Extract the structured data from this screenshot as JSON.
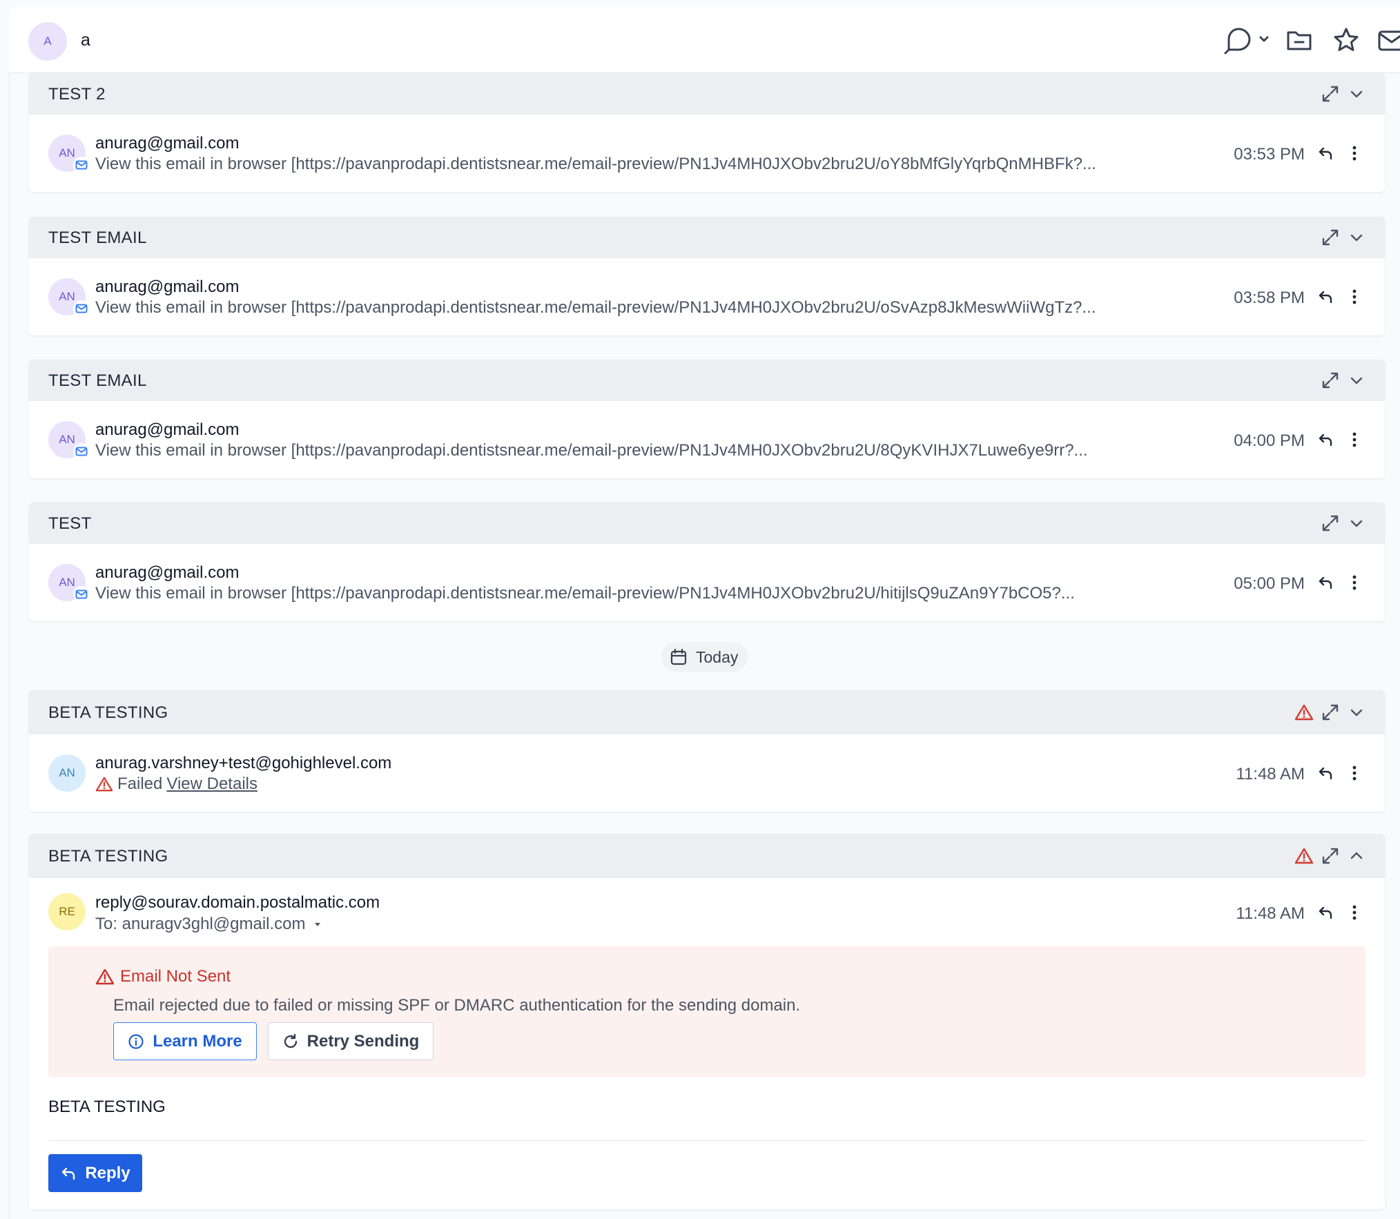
{
  "header": {
    "avatar_initials": "A",
    "contact_name": "a"
  },
  "threads": [
    {
      "subject": "TEST 2",
      "sender": "anurag@gmail.com",
      "avatar": "AN",
      "preview": "View this email in browser [https://pavanprodapi.dentistsnear.me/email-preview/PN1Jv4MH0JXObv2bru2U/oY8bMfGlyYqrbQnMHBFk?...",
      "time": "03:53 PM"
    },
    {
      "subject": "TEST EMAIL",
      "sender": "anurag@gmail.com",
      "avatar": "AN",
      "preview": "View this email in browser [https://pavanprodapi.dentistsnear.me/email-preview/PN1Jv4MH0JXObv2bru2U/oSvAzp8JkMeswWiiWgTz?...",
      "time": "03:58 PM"
    },
    {
      "subject": "TEST EMAIL",
      "sender": "anurag@gmail.com",
      "avatar": "AN",
      "preview": "View this email in browser [https://pavanprodapi.dentistsnear.me/email-preview/PN1Jv4MH0JXObv2bru2U/8QyKVIHJX7Luwe6ye9rr?...",
      "time": "04:00 PM"
    },
    {
      "subject": "TEST",
      "sender": "anurag@gmail.com",
      "avatar": "AN",
      "preview": "View this email in browser [https://pavanprodapi.dentistsnear.me/email-preview/PN1Jv4MH0JXObv2bru2U/hitijlsQ9uZAn9Y7bCO5?...",
      "time": "05:00 PM"
    }
  ],
  "date_separator": "Today",
  "failed_thread": {
    "subject": "BETA TESTING",
    "sender": "anurag.varshney+test@gohighlevel.com",
    "avatar": "AN",
    "status": "Failed",
    "view_details": "View Details",
    "time": "11:48 AM"
  },
  "expanded_thread": {
    "subject": "BETA TESTING",
    "sender": "reply@sourav.domain.postalmatic.com",
    "avatar": "RE",
    "to_line": "To: anuragv3ghl@gmail.com",
    "time": "11:48 AM",
    "error_title": "Email Not Sent",
    "error_message": "Email rejected due to failed or missing SPF or DMARC authentication for the sending domain.",
    "learn_more": "Learn More",
    "retry": "Retry Sending",
    "body": "BETA TESTING",
    "reply": "Reply"
  },
  "colors": {
    "error": "#c8322c",
    "primary": "#1f5fe0",
    "header_bg": "#eceef1"
  }
}
